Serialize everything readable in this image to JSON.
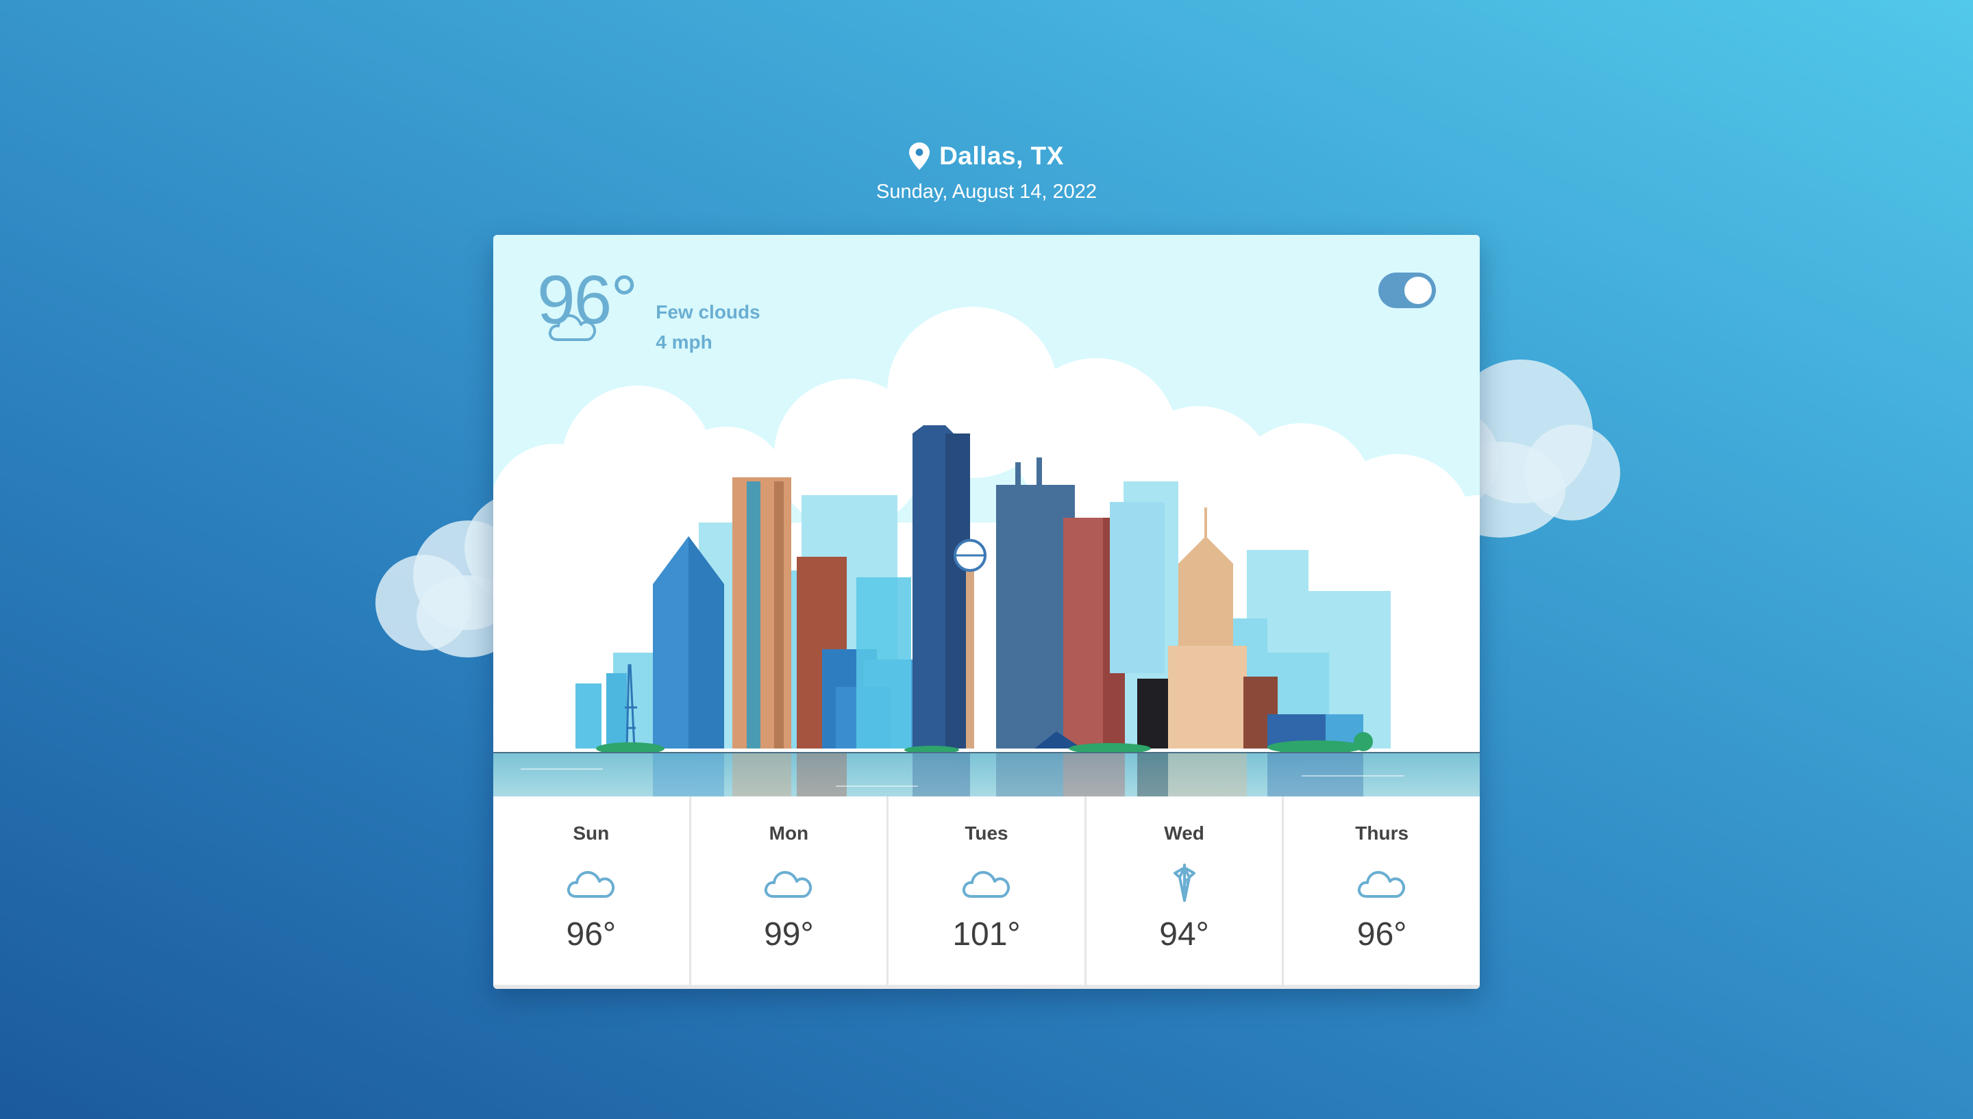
{
  "header": {
    "location_icon": "map-pin-icon",
    "location": "Dallas, TX",
    "date": "Sunday, August 14, 2022"
  },
  "current": {
    "temperature": "96°",
    "icon": "cloud-icon",
    "condition": "Few clouds",
    "wind": "4 mph"
  },
  "toggle": {
    "state": "on"
  },
  "forecast": [
    {
      "day": "Sun",
      "icon": "cloud-icon",
      "temp": "96°"
    },
    {
      "day": "Mon",
      "icon": "cloud-icon",
      "temp": "99°"
    },
    {
      "day": "Tues",
      "icon": "cloud-icon",
      "temp": "101°"
    },
    {
      "day": "Wed",
      "icon": "umbrella-icon",
      "temp": "94°"
    },
    {
      "day": "Thurs",
      "icon": "cloud-icon",
      "temp": "96°"
    }
  ],
  "colors": {
    "accent": "#6aaed2",
    "sky": "#d9f9fd",
    "toggle": "#5d9cc8"
  }
}
